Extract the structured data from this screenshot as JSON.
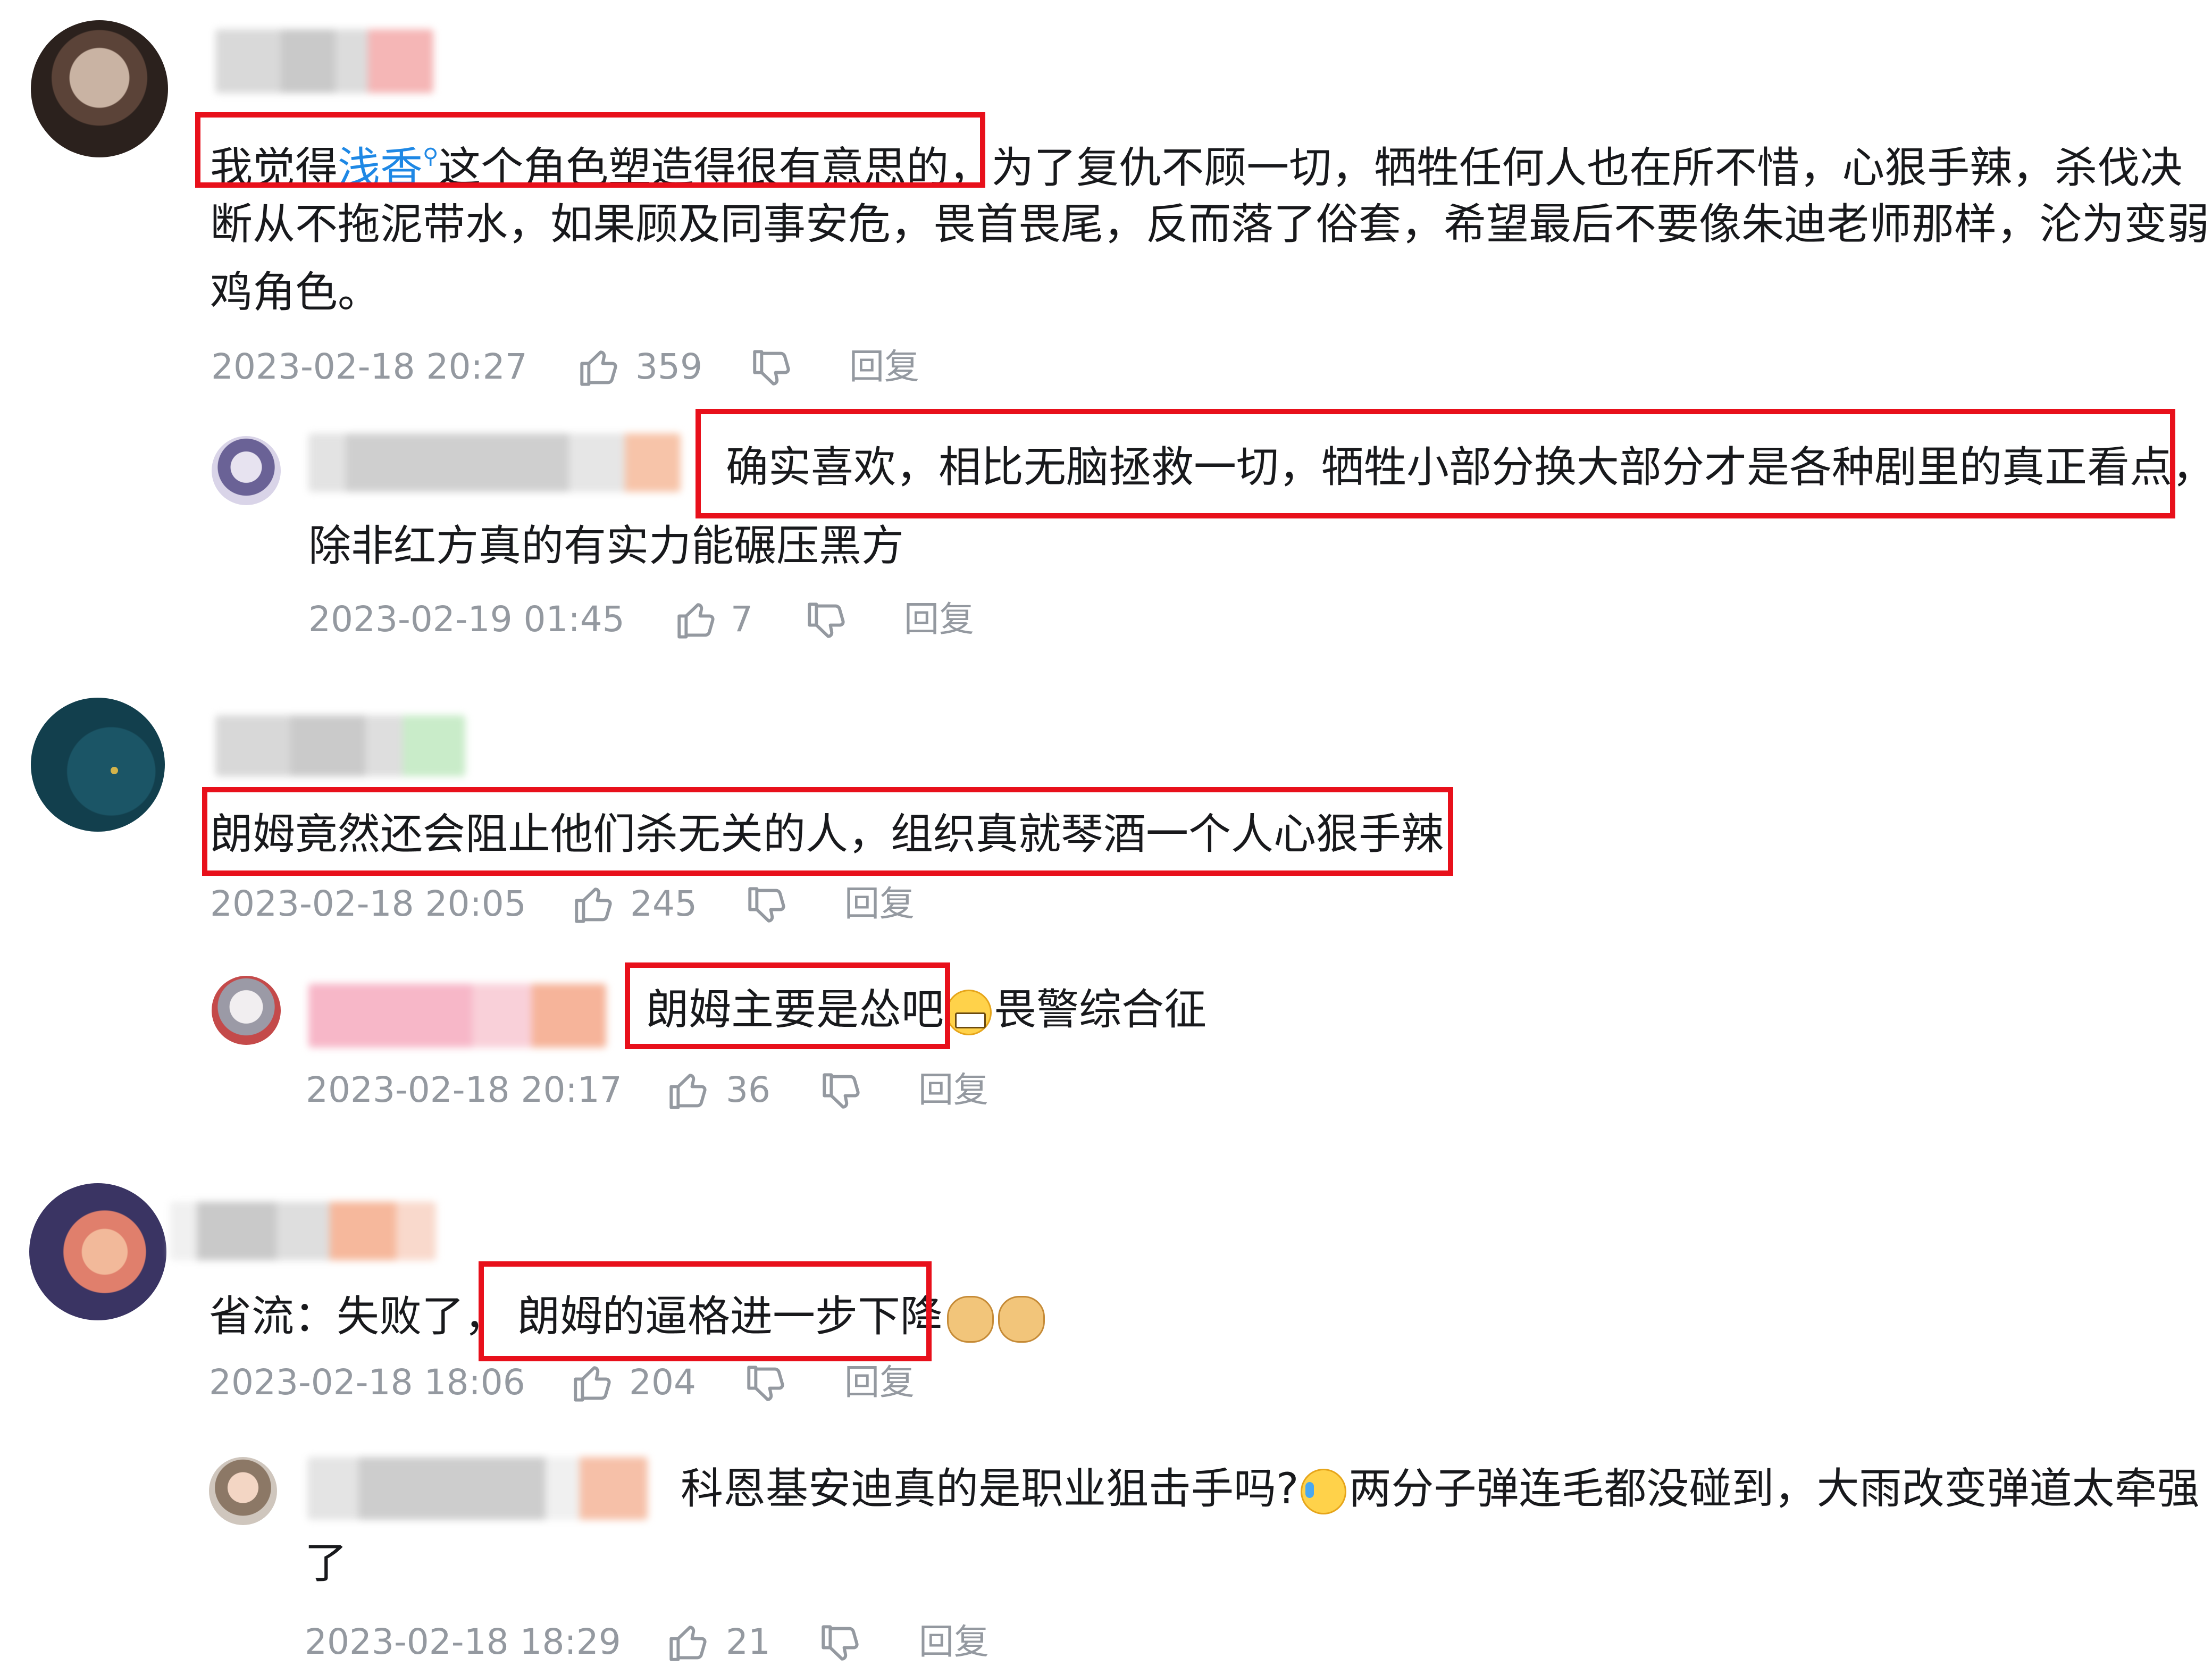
{
  "colors": {
    "highlight_box": "#e8101b",
    "link": "#1e88e5",
    "meta": "#9499a0",
    "text": "#18191c"
  },
  "icons": {
    "like": "thumb-up-icon",
    "dislike": "thumb-down-icon",
    "search": "search-icon"
  },
  "comments": [
    {
      "line1_pre": "我觉得",
      "line1_link": "浅香",
      "line1_post": "这个角色塑造得很有意思的，为了复仇不顾一切，牺牲任何人也在所不惜，心狠手辣，杀伐决",
      "line2": "断从不拖泥带水，如果顾及同事安危，畏首畏尾，反而落了俗套，希望最后不要像朱迪老师那样，沦为变弱",
      "line3": "鸡角色。",
      "time": "2023-02-18 20:27",
      "likes": "359",
      "reply_label": "回复",
      "reply": {
        "line1": "确实喜欢，相比无脑拯救一切，牺牲小部分换大部分才是各种剧里的真正看点，",
        "line2": "除非红方真的有实力能碾压黑方",
        "time": "2023-02-19 01:45",
        "likes": "7",
        "reply_label": "回复"
      }
    },
    {
      "line1": "朗姆竟然还会阻止他们杀无关的人，组织真就琴酒一个人心狠手辣",
      "time": "2023-02-18 20:05",
      "likes": "245",
      "reply_label": "回复",
      "reply": {
        "line1_pre": "朗姆主要是怂吧",
        "line1_post": "畏警综合征",
        "emoji": "grin-emoji",
        "time": "2023-02-18 20:17",
        "likes": "36",
        "reply_label": "回复"
      }
    },
    {
      "line1_pre": "省流：失败了，",
      "line1_post": "朗姆的逼格进一步下降",
      "emoji": "doge-emoji",
      "time": "2023-02-18 18:06",
      "likes": "204",
      "reply_label": "回复",
      "reply": {
        "line1_pre": "科恩基安迪真的是职业狙击手吗?",
        "line1_post": "两分子弹连毛都没碰到，大雨改变弹道太牵强",
        "line2": "了",
        "emoji": "cry-laugh-emoji",
        "time": "2023-02-18 18:29",
        "likes": "21",
        "reply_label": "回复"
      }
    }
  ]
}
